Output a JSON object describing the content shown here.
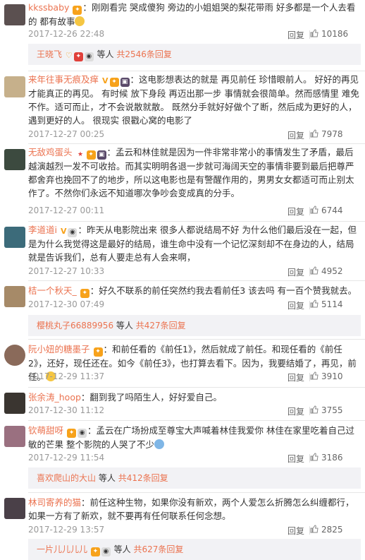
{
  "comments": [
    {
      "user": "kkssbaby",
      "colon": "：",
      "text": "刚刚看完  哭成傻狗  旁边的小姐姐哭的梨花带雨  好多都是一个人去看的  都有故事",
      "time": "2017-12-26 22:48",
      "reply": "回复",
      "likes": "10186",
      "avatar_color": "#5b5050",
      "replies": {
        "name": "王晓飞",
        "mid": "等人",
        "count": "共2546条回复"
      }
    },
    {
      "user": "来年往事无痕及痒",
      "colon": "：",
      "text": "这电影想表达的就是 再见前任 珍惜眼前人。  好好的再见才能真正的再见。  有时候 放下身段 再迈出那一步 事情就会很简单。然而感情里 难免不作。适可而止，才不会说散就散。  既然分手就好好做个了断，然后成为更好的人，遇到更好的人。  很现实 很戳心窝的电影了",
      "time": "2017-12-27 00:25",
      "reply": "回复",
      "likes": "7978",
      "avatar_color": "#c6b08b"
    },
    {
      "user": "无敌鸡蛋头",
      "colon": "：",
      "text": "孟云和林佳就是因为一件非常非常小的事情发生了矛盾，最后越演越烈一发不可收拾。而其实明明各退一步就可海阔天空的事情非要到最后把尊严都舍弃也挽回不了的地步，所以这电影也是有警醒作用的，男男女女都适可而止别太作了。不然你们永远不知道哪次争吵会变成真的分手。",
      "time": "2017-12-27 00:11",
      "reply": "回复",
      "likes": "6744",
      "avatar_color": "#3c4a3f"
    },
    {
      "user": "李道道i",
      "colon": "：",
      "text": "昨天从电影院出来 很多人都说结局不好 为什么他们最后没在一起，但是为什么我觉得这是最好的结局，谁生命中没有一个记忆深刻却不在身边的人，结局就是告诉我们，总有人要走总有人会来啊，",
      "time": "2017-12-27 10:33",
      "reply": "回复",
      "likes": "4952",
      "avatar_color": "#3c6b7a"
    },
    {
      "user": "桔一个秋天_",
      "colon": "：",
      "text": "好久不联系的前任突然约我去看前任3 该去吗 有一百个赞我就去。",
      "time": "2017-12-30 07:49",
      "reply": "回复",
      "likes": "5114",
      "avatar_color": "#a68a68",
      "replies": {
        "name": "樱桃丸子66889956",
        "mid": "等人",
        "count": "共427条回复"
      }
    },
    {
      "user": "阮小妞的糖墨子",
      "colon": "：",
      "text": "和前任看的《前任1》，然后就成了前任。和现任看的《前任2》，还好，现任还在。如今《前任3》，也打算去看下。因为，我要结婚了，再见，前任。",
      "time": "2017-12-29 11:37",
      "reply": "回复",
      "likes": "3910",
      "avatar_color": "#8a6a5a"
    },
    {
      "user": "张余涛_hoop",
      "colon": "：",
      "text": "翻到我了吗陌生人，好好爱自己。",
      "time": "2017-12-30 11:12",
      "reply": "回复",
      "likes": "3755",
      "avatar_color": "#3a3530"
    },
    {
      "user": "钦萌甜呀",
      "colon": "：",
      "text": "孟云在广场扮成至尊宝大声喊着林佳我爱你 林佳在家里吃着自己过敏的芒果 整个影院的人哭了不少",
      "time": "2017-12-29 11:54",
      "reply": "回复",
      "likes": "3186",
      "avatar_color": "#9a7080",
      "replies": {
        "name": "喜欢爬山的大山",
        "mid": "等人",
        "count": "共412条回复"
      }
    },
    {
      "user": "林司寄养的猫",
      "colon": "：",
      "text": "前任这种生物，如果你没有新欢，两个人爱怎么折腾怎么纠缠都行，如果一方有了新欢，就不要再有任何联系任何念想。",
      "time": "2017-12-29 13:57",
      "reply": "回复",
      "likes": "2825",
      "avatar_color": "#4a4048",
      "replies": {
        "name": "一片儿儿儿儿",
        "mid": "等人",
        "count": "共627条回复"
      }
    }
  ]
}
